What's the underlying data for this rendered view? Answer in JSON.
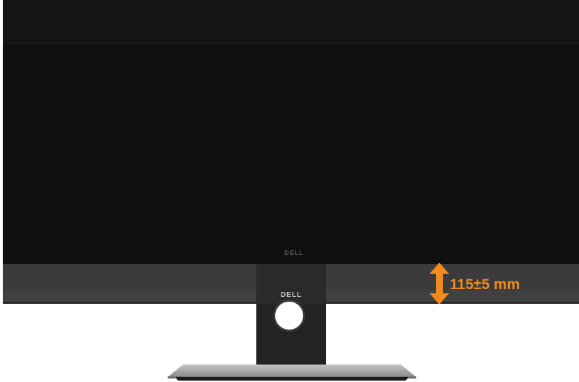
{
  "monitor": {
    "upper_logo": "DELL",
    "stand_logo": "DELL"
  },
  "height_adjustment": {
    "label": "115±5 mm",
    "icon": "up-down-arrow-icon",
    "color": "#f28a1d"
  },
  "colors": {
    "panel": "#0f0f0f",
    "bezel_band": "#404040",
    "stand": "#232323",
    "base": "#9a9a9a"
  }
}
